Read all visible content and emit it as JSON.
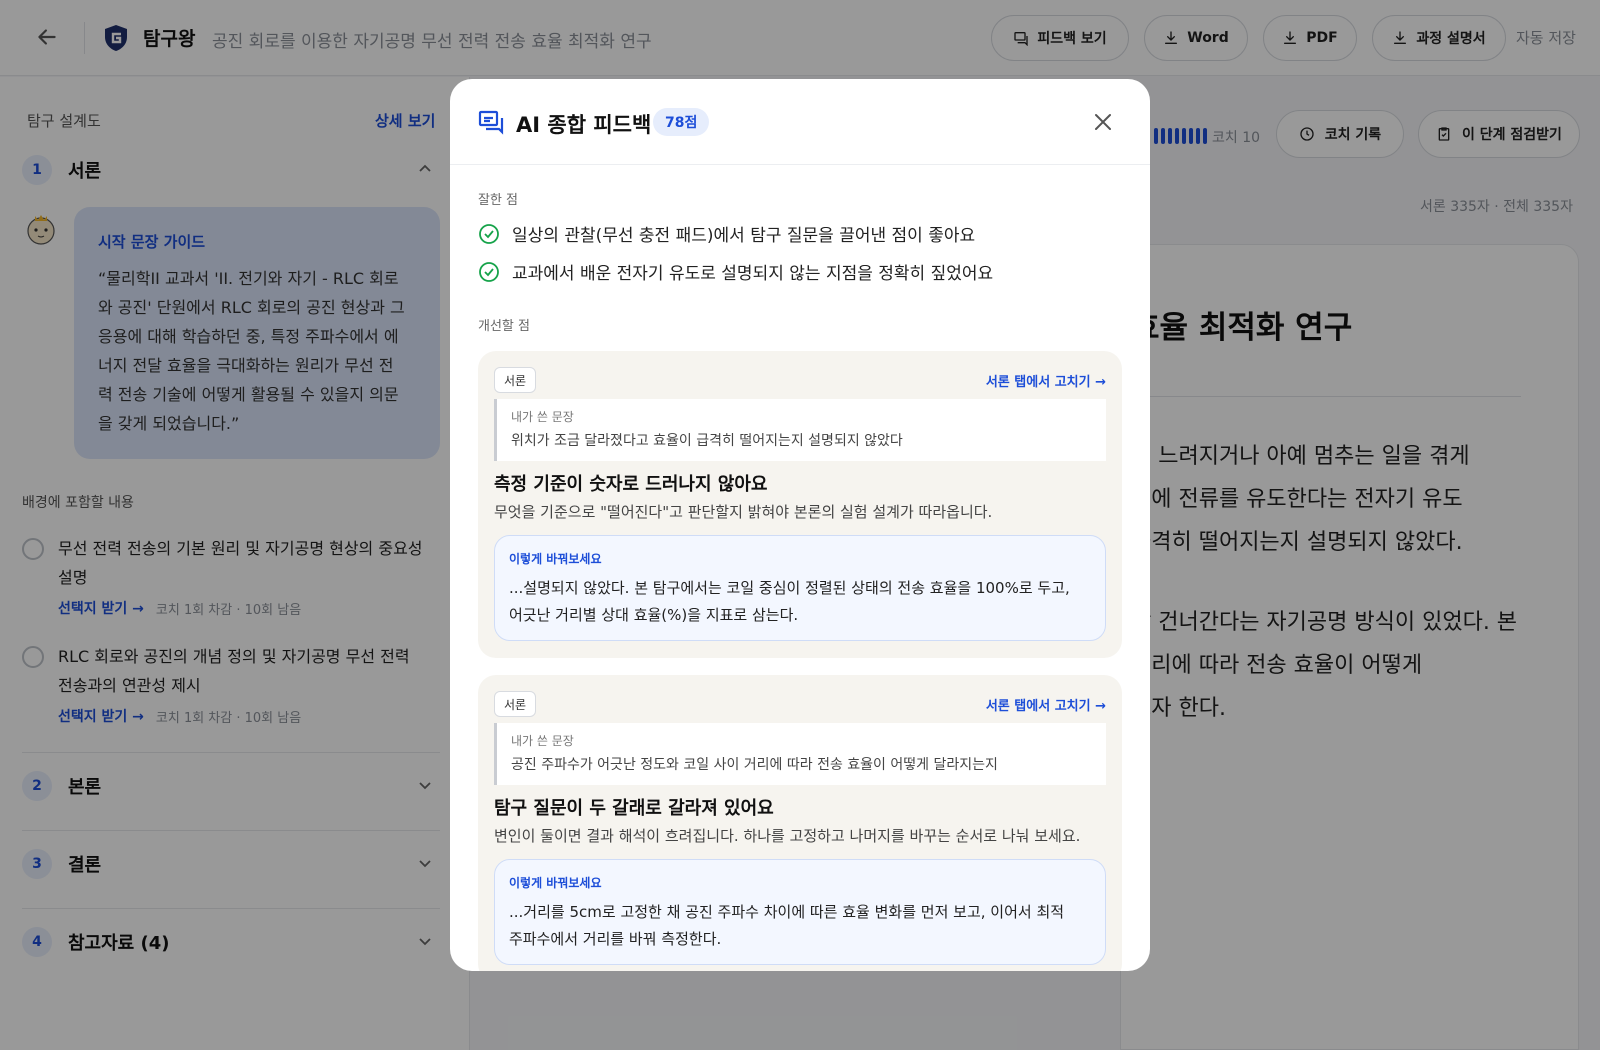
{
  "header": {
    "brand": "탐구왕",
    "doc_title": "공진 회로를 이용한 자기공명 무선 전력 전송 효율 최적화 연구",
    "buttons": {
      "feedback": "피드백 보기",
      "word": "Word",
      "pdf": "PDF",
      "process": "과정 설명서"
    },
    "autosave": "자동 저장"
  },
  "sidebar": {
    "heading": "탐구 설계도",
    "detail_link": "상세 보기",
    "sections": [
      {
        "num": "1",
        "label": "서론"
      },
      {
        "num": "2",
        "label": "본론"
      },
      {
        "num": "3",
        "label": "결론"
      },
      {
        "num": "4",
        "label": "참고자료 (4)"
      }
    ],
    "guide": {
      "title": "시작 문장 가이드",
      "lines": [
        "“물리학II 교과서 'II. 전기와 자기 - RLC 회로",
        "와 공진' 단원에서 RLC 회로의 공진 현상과 그",
        "응용에 대해 학습하던 중, 특정 주파수에서 에",
        "너지 전달 효율을 극대화하는 원리가 무선 전",
        "력 전송 기술에 어떻게 활용될 수 있을지 의문",
        "을 갖게 되었습니다.”"
      ]
    },
    "background_heading": "배경에 포함할 내용",
    "background_items": [
      {
        "lines": [
          "무선 전력 전송의 기본 원리 및 자기공명 현상의 중요성",
          "설명"
        ],
        "action": "선택지 받기 →",
        "meta": "코치 1회 차감 · 10회 남음"
      },
      {
        "lines": [
          "RLC 회로와 공진의 개념 정의 및 자기공명 무선 전력",
          "전송과의 연관성 제시"
        ],
        "action": "선택지 받기 →",
        "meta": "코치 1회 차감 · 10회 남음"
      }
    ]
  },
  "main": {
    "coach_count": "코치 10",
    "coach_level": 10,
    "coach_log": "코치 기록",
    "check_stage": "이 단계 점검받기",
    "word_count": "서론 335자 · 전체 335자",
    "paper_title": "효율 최적화 연구",
    "paper_lines": [
      "이 느려지거나 아예 멈추는 일을 겪게",
      "일에 전류를 유도한다는 전자기 유도",
      "급격히 떨어지는지 설명되지 않았다.",
      "할 건너간다는 자기공명 방식이 있었다. 본",
      "거리에 따라 전송 효율이 어떻게",
      "고자 한다."
    ]
  },
  "modal": {
    "title": "AI 종합 피드백",
    "score": "78점",
    "good_label": "잘한 점",
    "good_points": [
      "일상의 관찰(무선 충전 패드)에서 탐구 질문을 끌어낸 점이 좋아요",
      "교과에서 배운 전자기 유도로 설명되지 않는 지점을 정확히 짚었어요"
    ],
    "improve_label": "개선할 점",
    "cards": [
      {
        "tag": "서론",
        "fix_link": "서론 탭에서 고치기 →",
        "mine_label": "내가 쓴 문장",
        "mine_text": "위치가 조금 달라졌다고 효율이 급격히 떨어지는지 설명되지 않았다",
        "heading": "측정 기준이 숫자로 드러나지 않아요",
        "desc": "무엇을 기준으로 \"떨어진다\"고 판단할지 밝혀야 본론의 실험 설계가 따라옵니다.",
        "sug_label": "이렇게 바꿔보세요",
        "sug_lines": [
          "...설명되지 않았다. 본 탐구에서는 코일 중심이 정렬된 상태의 전송 효율을 100%로 두고,",
          "어긋난 거리별 상대 효율(%)을 지표로 삼는다."
        ]
      },
      {
        "tag": "서론",
        "fix_link": "서론 탭에서 고치기 →",
        "mine_label": "내가 쓴 문장",
        "mine_text": "공진 주파수가 어긋난 정도와 코일 사이 거리에 따라 전송 효율이 어떻게 달라지는지",
        "heading": "탐구 질문이 두 갈래로 갈라져 있어요",
        "desc": "변인이 둘이면 결과 해석이 흐려집니다. 하나를 고정하고 나머지를 바꾸는 순서로 나눠 보세요.",
        "sug_label": "이렇게 바꿔보세요",
        "sug_lines": [
          "...거리를 5cm로 고정한 채 공진 주파수 차이에 따른 효율 변화를 먼저 보고, 이어서 최적",
          "주파수에서 거리를 바꿔 측정한다."
        ]
      }
    ]
  },
  "colors": {
    "accent": "#1d4ed8",
    "good_check": "#16a34a",
    "guide_bg": "#dbe5fa",
    "card_bg": "#f6f4ef",
    "suggest_bg": "#f3f7ff"
  },
  "icons": [
    "back-arrow-icon",
    "logo-icon",
    "chat-icon",
    "download-icon",
    "chevron-up-icon",
    "chevron-down-icon",
    "clock-icon",
    "clipboard-check-icon",
    "close-icon",
    "check-circle-icon",
    "mascot-icon"
  ]
}
